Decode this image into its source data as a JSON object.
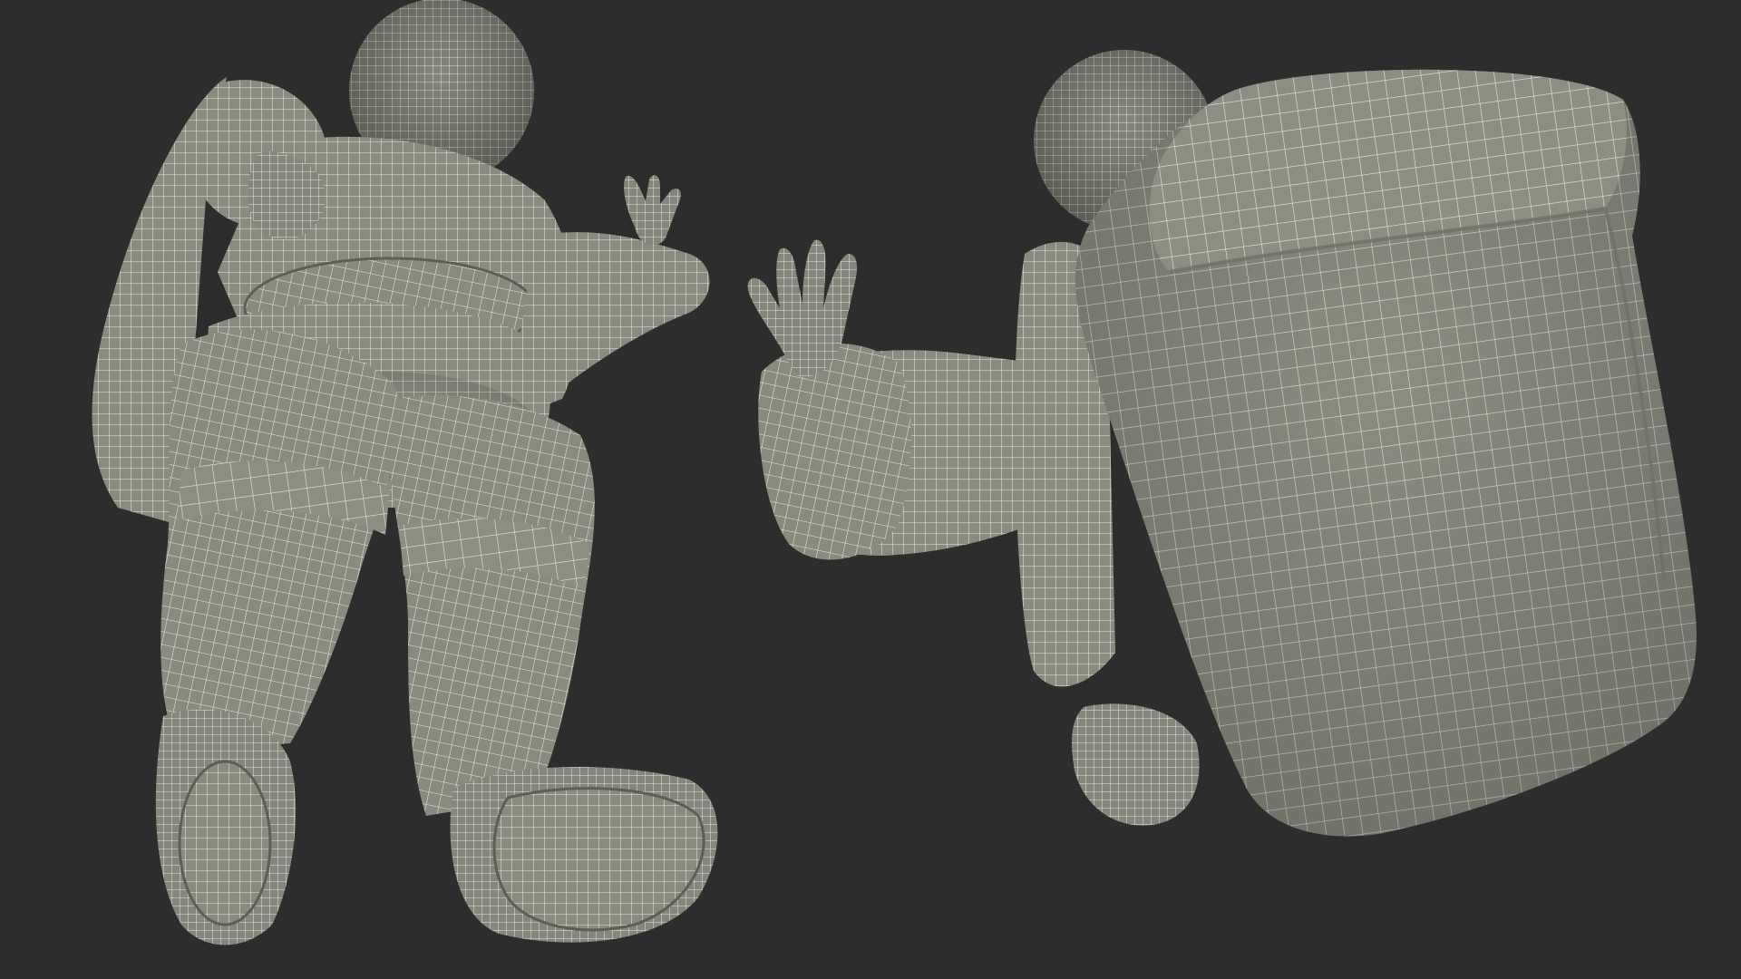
{
  "scene": {
    "background_color": "#2d2d2d",
    "mesh_fill_color": "#8a8b7f",
    "mesh_line_color": "#e6e6d8",
    "mesh_shadow_color": "#6f7066",
    "subjects": [
      {
        "name": "astronaut-low-angle-view",
        "description_icon": "astronaut-wireframe-front"
      },
      {
        "name": "astronaut-back-view",
        "description_icon": "astronaut-wireframe-back"
      }
    ]
  }
}
